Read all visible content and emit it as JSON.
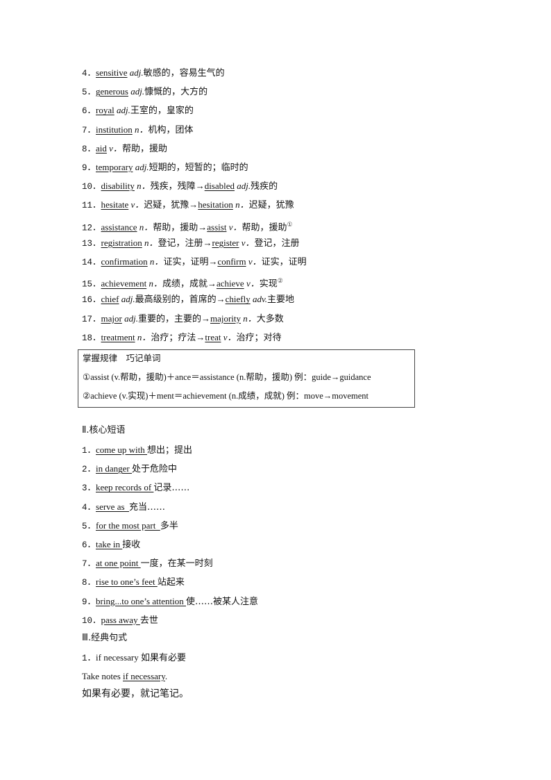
{
  "vocab": [
    {
      "n": "4．",
      "word": "sensitive",
      "pos": "adj.",
      "meaning": "敏感的，容易生气的"
    },
    {
      "n": "5．",
      "word": "generous",
      "pos": "adj.",
      "meaning": "慷慨的，大方的"
    },
    {
      "n": "6．",
      "word": "royal",
      "pos": "adj.",
      "meaning": "王室的，皇家的"
    },
    {
      "n": "7．",
      "word": "institution",
      "pos": "n．",
      "meaning": "机构，团体"
    },
    {
      "n": "8．",
      "word": "aid",
      "pos": "v．",
      "meaning": "帮助，援助"
    },
    {
      "n": "9．",
      "word": "temporary",
      "pos": "adj.",
      "meaning": "短期的，短暂的；临时的"
    },
    {
      "n": "10．",
      "word": "disability",
      "pos": "n．",
      "meaning": "残疾，残障",
      "arrow": "→",
      "word2": "disabled",
      "pos2": "adj.",
      "meaning2": "残疾的"
    },
    {
      "n": "11．",
      "word": "hesitate",
      "pos": "v．",
      "meaning": "迟疑，犹豫",
      "arrow": "→",
      "word2": "hesitation",
      "pos2": "n．",
      "meaning2": "迟疑，犹豫"
    },
    {
      "n": "12．",
      "word": "assistance",
      "pos": "n．",
      "meaning": "帮助，援助",
      "arrow": "→",
      "word2": "assist",
      "pos2": "v．",
      "meaning2": "帮助，援助",
      "note": "①"
    },
    {
      "n": "13．",
      "word": "registration",
      "pos": "n．",
      "meaning": "登记，注册",
      "arrow": "→",
      "word2": "register",
      "pos2": "v．",
      "meaning2": "登记，注册"
    },
    {
      "n": "14．",
      "word": "confirmation",
      "pos": "n．",
      "meaning": "证实，证明",
      "arrow": "→",
      "word2": "confirm",
      "pos2": "v．",
      "meaning2": "证实，证明"
    },
    {
      "n": "15．",
      "word": "achievement",
      "pos": "n．",
      "meaning": "成绩，成就",
      "arrow": "→",
      "word2": "achieve",
      "pos2": "v．",
      "meaning2": "实现",
      "note": "②"
    },
    {
      "n": "16．",
      "word": "chief",
      "pos": "adj.",
      "meaning": "最高级别的，首席的",
      "arrow": "→",
      "word2": "chiefly",
      "pos2": "adv.",
      "meaning2": "主要地"
    },
    {
      "n": "17．",
      "word": "major",
      "pos": "adj.",
      "meaning": "重要的，主要的",
      "arrow": "→",
      "word2": "majority",
      "pos2": "n．",
      "meaning2": "大多数"
    },
    {
      "n": "18．",
      "word": "treatment",
      "pos": "n．",
      "meaning": "治疗；疗法",
      "arrow": "→",
      "word2": "treat",
      "pos2": "v．",
      "meaning2": "治疗；对待"
    }
  ],
  "tip_box": {
    "title": "掌握规律　巧记单词",
    "line1": "①assist (v.帮助，援助)＋ance＝assistance (n.帮助，援助) 例：guide→guidance",
    "line2": "②achieve (v.实现)＋ment＝achievement (n.成绩，成就) 例：move→movement"
  },
  "section2": {
    "title": "Ⅱ.核心短语",
    "phrases": [
      {
        "n": "1．",
        "phrase": "come up with ",
        "meaning": "想出；提出"
      },
      {
        "n": "2．",
        "phrase": "in danger ",
        "meaning": "处于危险中"
      },
      {
        "n": "3．",
        "phrase": "keep records of ",
        "meaning": "记录……"
      },
      {
        "n": "4．",
        "phrase": "serve as  ",
        "meaning": "充当……"
      },
      {
        "n": "5．",
        "phrase": "for the most part  ",
        "meaning": "多半"
      },
      {
        "n": "6．",
        "phrase": "take in ",
        "meaning": "接收"
      },
      {
        "n": "7．",
        "phrase": "at one point ",
        "meaning": "一度，在某一时刻"
      },
      {
        "n": "8．",
        "phrase": "rise to one’s feet ",
        "meaning": "站起来"
      },
      {
        "n": "9．",
        "phrase": "bring...to one’s attention ",
        "meaning": "使……被某人注意"
      },
      {
        "n": "10．",
        "phrase": "pass away ",
        "meaning": "去世"
      }
    ]
  },
  "section3": {
    "title": "Ⅲ.经典句式",
    "item": {
      "n": "1．",
      "pattern": "if necessary",
      "meaning": "如果有必要"
    },
    "example_prefix": "Take notes ",
    "example_underlined": "if necessary",
    "example_suffix": ".",
    "translation": "如果有必要，就记笔记。"
  }
}
